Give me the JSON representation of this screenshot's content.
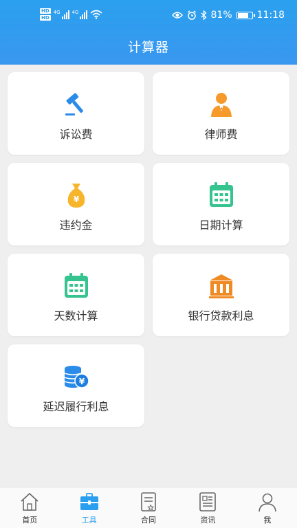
{
  "status_bar": {
    "hd1": "HD",
    "hd2": "HD",
    "net1": "4G",
    "net2": "4G",
    "battery_percent": "81%",
    "battery_level": 0.81,
    "time": "11:18"
  },
  "header": {
    "title": "计算器"
  },
  "tools": [
    {
      "label": "诉讼费",
      "icon": "gavel-icon"
    },
    {
      "label": "律师费",
      "icon": "lawyer-icon"
    },
    {
      "label": "违约金",
      "icon": "money-bag-icon"
    },
    {
      "label": "日期计算",
      "icon": "calendar-icon"
    },
    {
      "label": "天数计算",
      "icon": "calendar-icon"
    },
    {
      "label": "银行贷款利息",
      "icon": "bank-icon"
    },
    {
      "label": "延迟履行利息",
      "icon": "coins-yen-icon"
    }
  ],
  "nav": {
    "items": [
      {
        "label": "首页",
        "icon": "home-icon"
      },
      {
        "label": "工具",
        "icon": "toolbox-icon",
        "active": true
      },
      {
        "label": "合同",
        "icon": "contract-icon"
      },
      {
        "label": "资讯",
        "icon": "news-icon"
      },
      {
        "label": "我",
        "icon": "user-icon"
      }
    ]
  },
  "colors": {
    "header_blue": "#2aa0ee",
    "active_nav": "#2a9ff0",
    "orange": "#f59a2b",
    "green": "#35c38f",
    "blue_icon": "#2a8be8"
  }
}
